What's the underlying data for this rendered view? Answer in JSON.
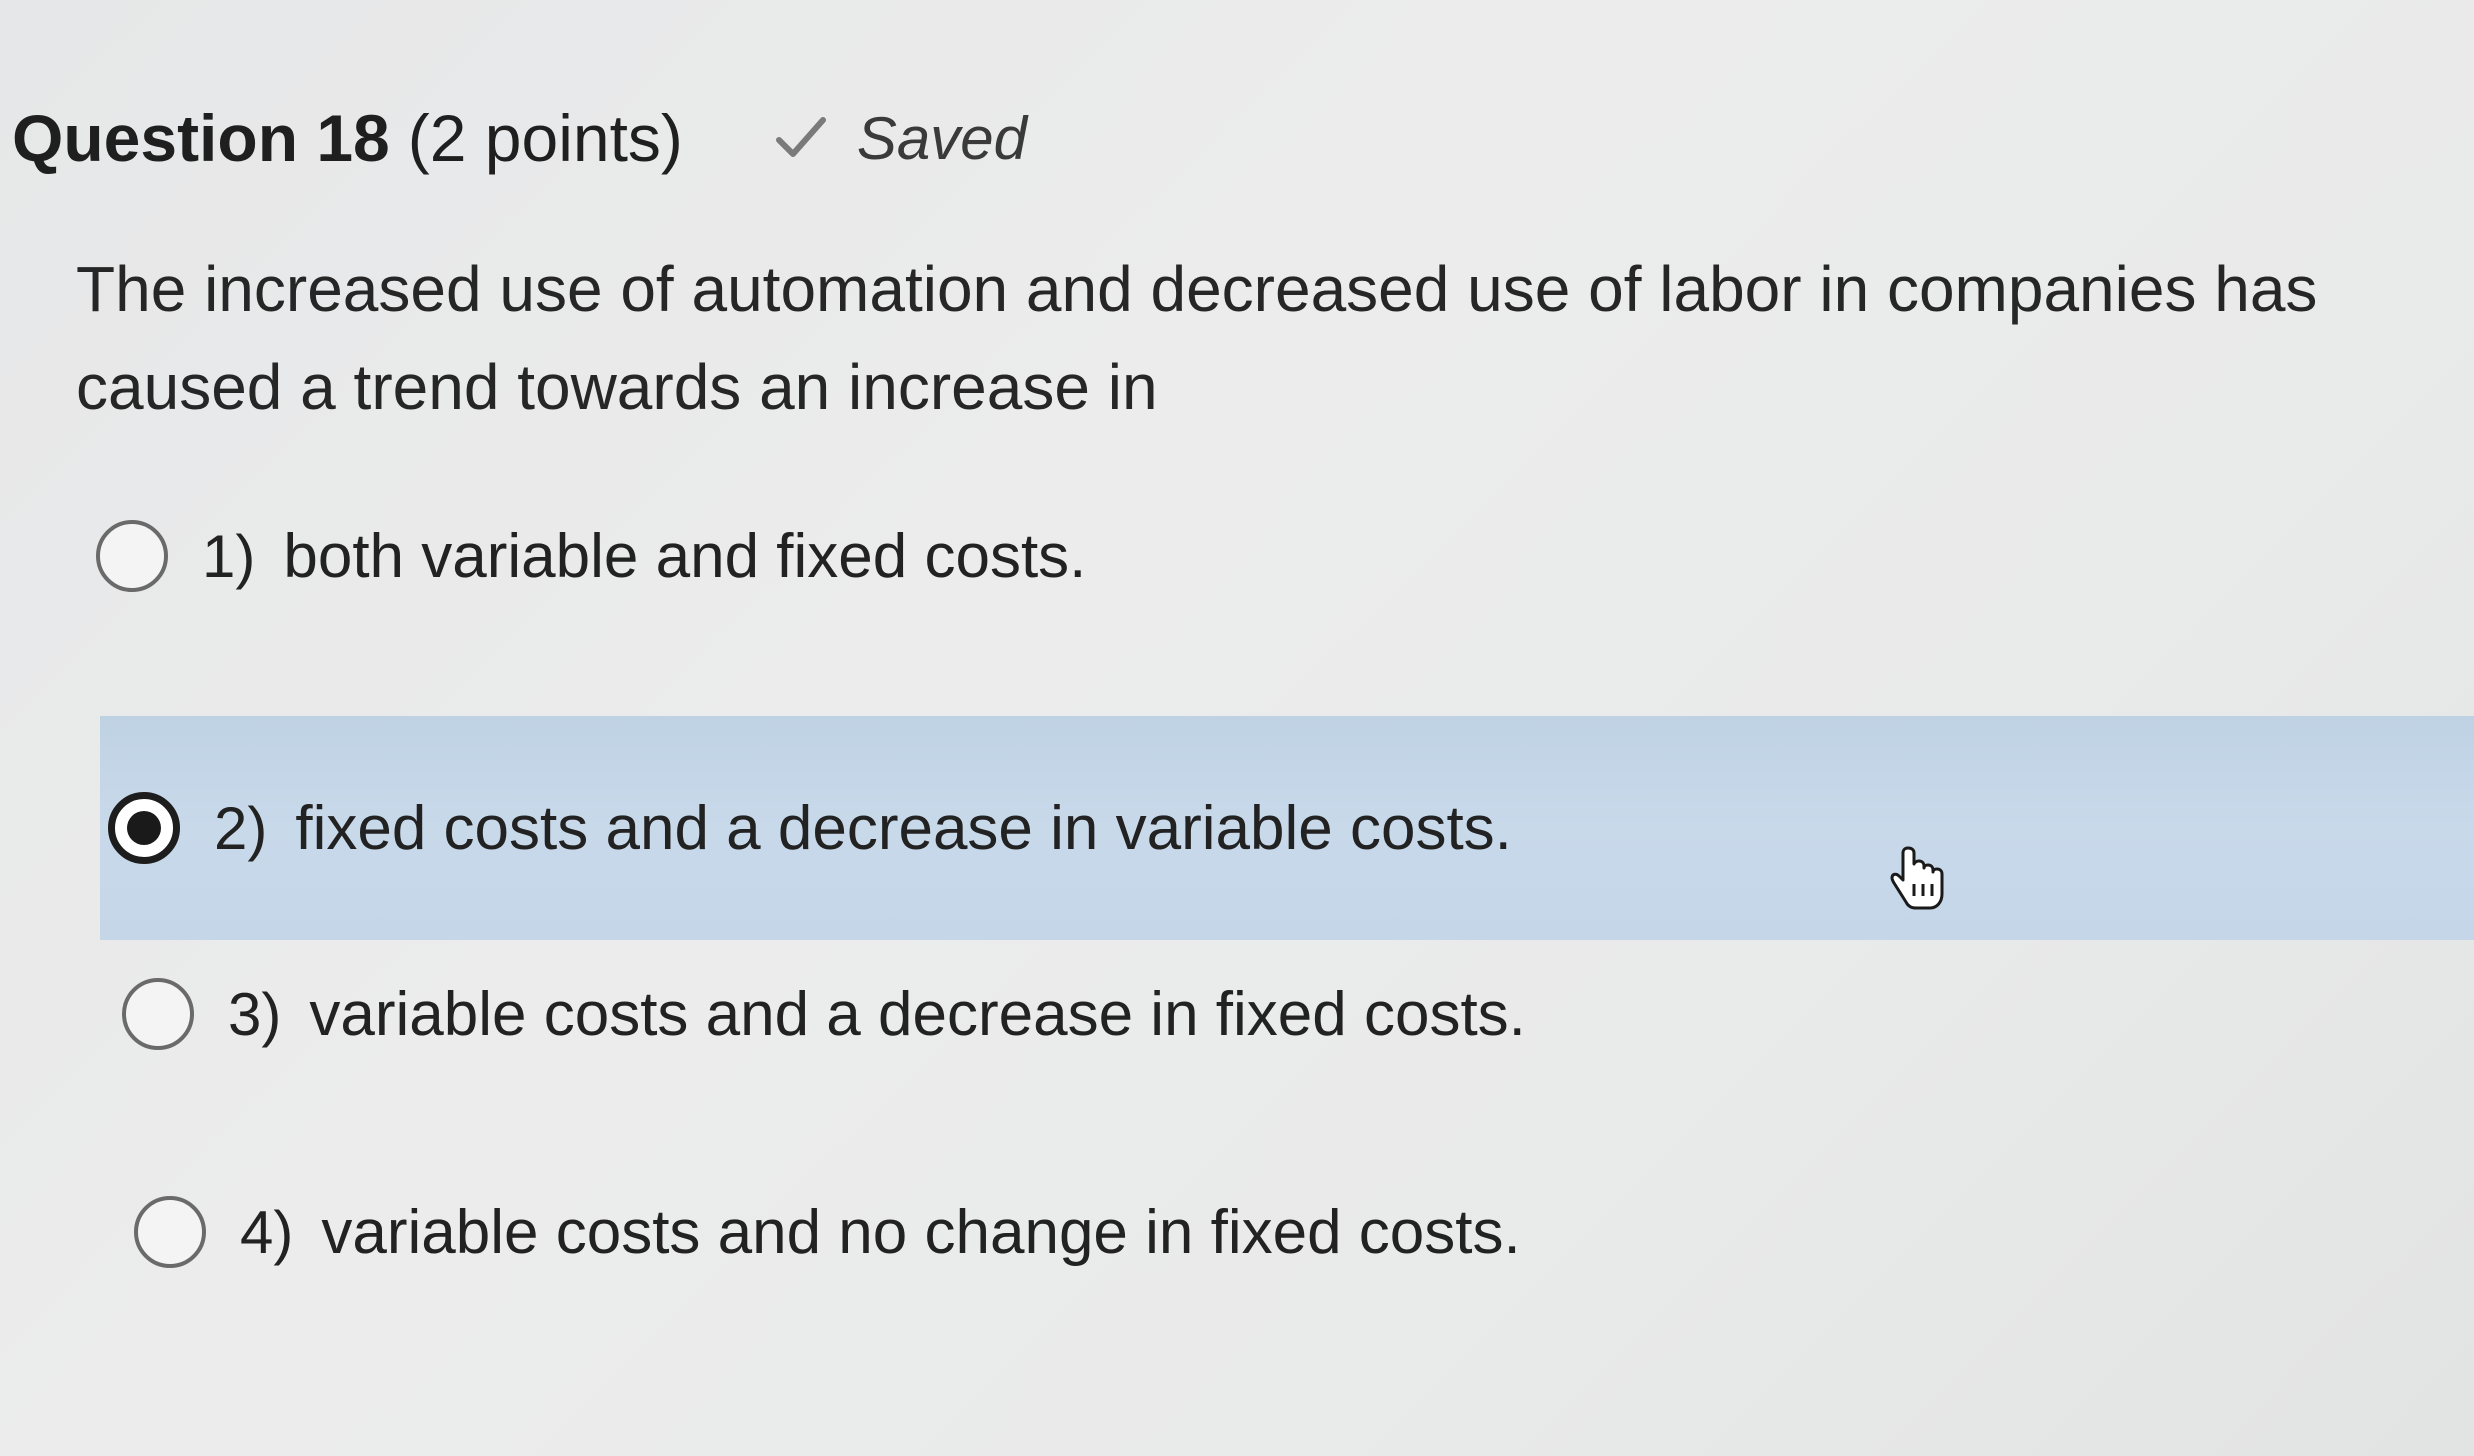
{
  "question": {
    "title": "Question 18",
    "points": "(2 points)",
    "status": "Saved",
    "status_icon": "checkmark-icon",
    "text": "The increased use of automation and decreased use of labor in companies has caused a trend towards an increase in"
  },
  "options": [
    {
      "number": "1)",
      "text": "both variable and fixed costs.",
      "selected": false
    },
    {
      "number": "2)",
      "text": "fixed costs and a decrease in variable costs.",
      "selected": true
    },
    {
      "number": "3)",
      "text": "variable costs and a decrease in fixed costs.",
      "selected": false
    },
    {
      "number": "4)",
      "text": "variable costs and no change in fixed costs.",
      "selected": false
    }
  ],
  "colors": {
    "selected_row": "#c4d6e8",
    "text": "#222222",
    "background": "#e8e9e9"
  },
  "cursor": "hand-pointer-icon"
}
